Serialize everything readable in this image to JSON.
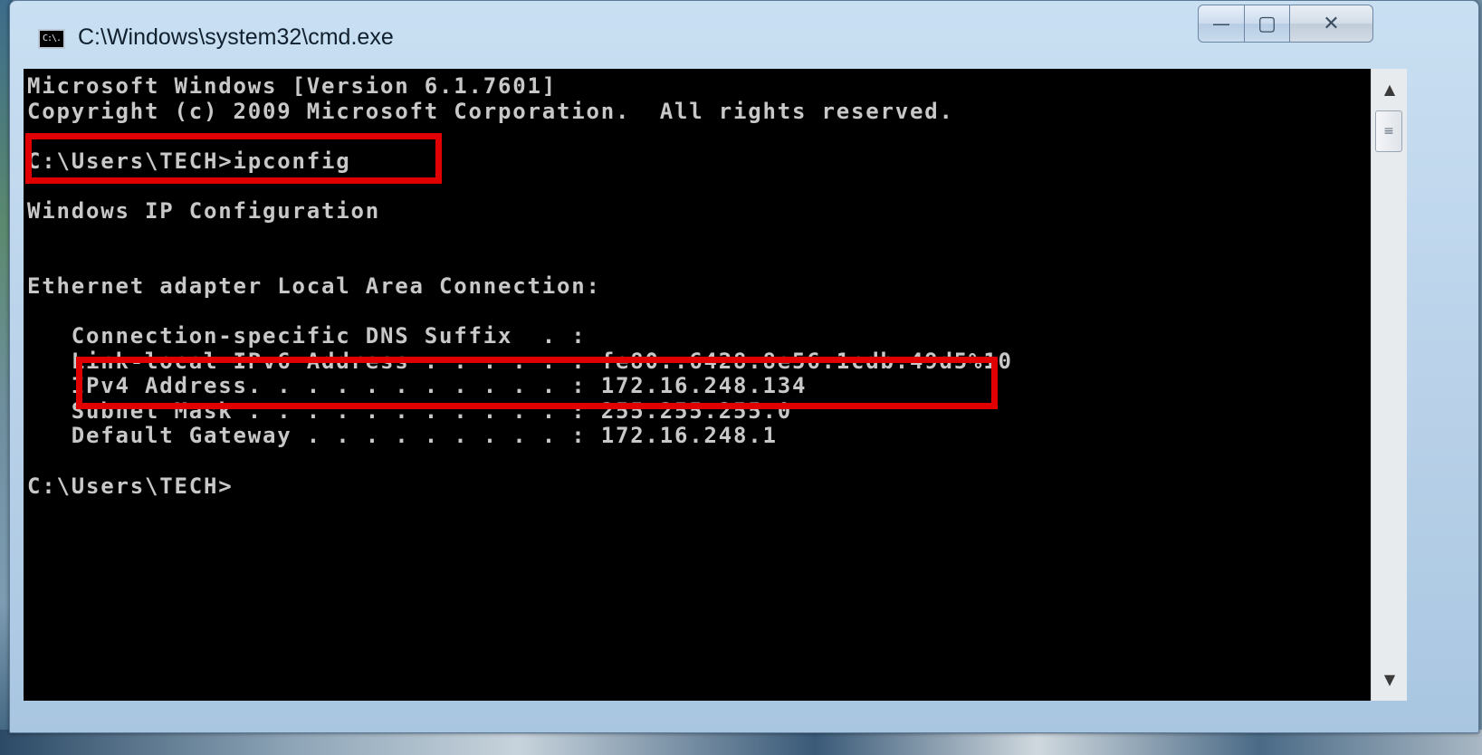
{
  "window": {
    "title": "C:\\Windows\\system32\\cmd.exe",
    "icon_text": "C:\\.",
    "icon": "cmd-icon"
  },
  "caption_buttons": {
    "minimize": "—",
    "maximize": "▢",
    "close": "✕"
  },
  "console": {
    "lines": [
      "Microsoft Windows [Version 6.1.7601]",
      "Copyright (c) 2009 Microsoft Corporation.  All rights reserved.",
      "",
      "C:\\Users\\TECH>ipconfig",
      "",
      "Windows IP Configuration",
      "",
      "",
      "Ethernet adapter Local Area Connection:",
      "",
      "   Connection-specific DNS Suffix  . :",
      "   Link-local IPv6 Address . . . . . : fe80::6428:8e56:1cdb:49d5%10",
      "   IPv4 Address. . . . . . . . . . . : 172.16.248.134",
      "   Subnet Mask . . . . . . . . . . . : 255.255.255.0",
      "   Default Gateway . . . . . . . . . : 172.16.248.1",
      "",
      "C:\\Users\\TECH>"
    ],
    "text_color": "#c8c8c8",
    "background": "#000000",
    "highlight_color": "#e00000"
  },
  "scrollbar": {
    "up_icon": "▲",
    "down_icon": "▼",
    "thumb_grip": "≡"
  }
}
